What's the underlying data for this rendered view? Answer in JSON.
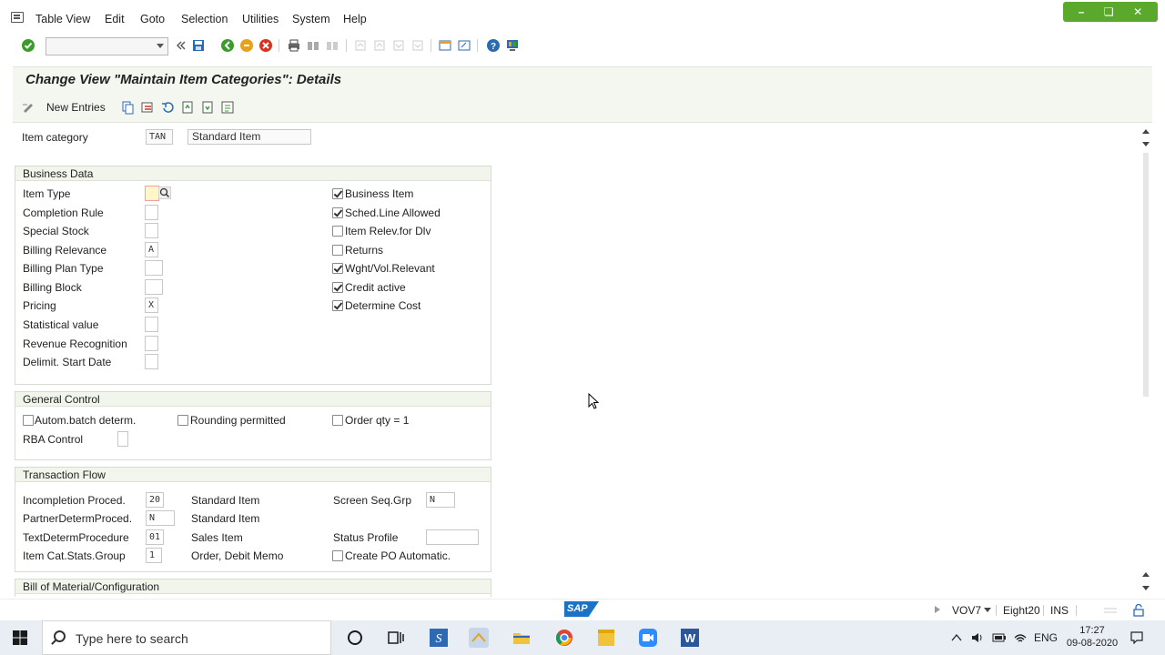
{
  "menu": {
    "items": [
      "Table View",
      "Edit",
      "Goto",
      "Selection",
      "Utilities",
      "System",
      "Help"
    ]
  },
  "toolbar": {
    "command_field": ""
  },
  "title": "Change View \"Maintain Item Categories\": Details",
  "app_toolbar": {
    "new_entries": "New Entries"
  },
  "header_fields": {
    "item_category_label": "Item category",
    "item_category_value": "TAN",
    "item_category_desc": "Standard Item"
  },
  "business_data": {
    "title": "Business Data",
    "labels": {
      "item_type": "Item Type",
      "completion_rule": "Completion Rule",
      "special_stock": "Special Stock",
      "billing_relevance": "Billing Relevance",
      "billing_plan_type": "Billing Plan Type",
      "billing_block": "Billing Block",
      "pricing": "Pricing",
      "statistical_value": "Statistical value",
      "revenue_recognition": "Revenue Recognition",
      "delimit_start_date": "Delimit. Start Date"
    },
    "values": {
      "item_type": "",
      "completion_rule": "",
      "special_stock": "",
      "billing_relevance": "A",
      "billing_plan_type": "",
      "billing_block": "",
      "pricing": "X",
      "statistical_value": "",
      "revenue_recognition": "",
      "delimit_start_date": ""
    },
    "checkboxes": [
      {
        "label": "Business Item",
        "checked": true
      },
      {
        "label": "Sched.Line Allowed",
        "checked": true
      },
      {
        "label": "Item Relev.for Dlv",
        "checked": false
      },
      {
        "label": "Returns",
        "checked": false
      },
      {
        "label": "Wght/Vol.Relevant",
        "checked": true
      },
      {
        "label": "Credit active",
        "checked": true
      },
      {
        "label": "Determine Cost",
        "checked": true
      }
    ]
  },
  "general_control": {
    "title": "General Control",
    "autom_batch": "Autom.batch determ.",
    "rounding": "Rounding permitted",
    "order_qty": "Order qty = 1",
    "rba_label": "RBA Control",
    "rba_value": ""
  },
  "transaction_flow": {
    "title": "Transaction Flow",
    "incompletion_label": "Incompletion Proced.",
    "incompletion_value": "20",
    "incompletion_desc": "Standard Item",
    "partner_label": "PartnerDetermProced.",
    "partner_value": "N",
    "partner_desc": "Standard Item",
    "text_label": "TextDetermProcedure",
    "text_value": "01",
    "text_desc": "Sales Item",
    "stats_label": "Item Cat.Stats.Group",
    "stats_value": "1",
    "stats_desc": "Order, Debit Memo",
    "screen_seq_label": "Screen Seq.Grp",
    "screen_seq_value": "N",
    "status_profile_label": "Status Profile",
    "status_profile_value": "",
    "create_po": "Create PO Automatic."
  },
  "bill_of_material": {
    "title": "Bill of Material/Configuration"
  },
  "status": {
    "sap_logo": "SAP",
    "transaction": "VOV7",
    "client": "Eight20",
    "mode": "INS"
  },
  "taskbar": {
    "search_placeholder": "Type here to search",
    "language": "ENG",
    "time": "17:27",
    "date": "09-08-2020"
  }
}
